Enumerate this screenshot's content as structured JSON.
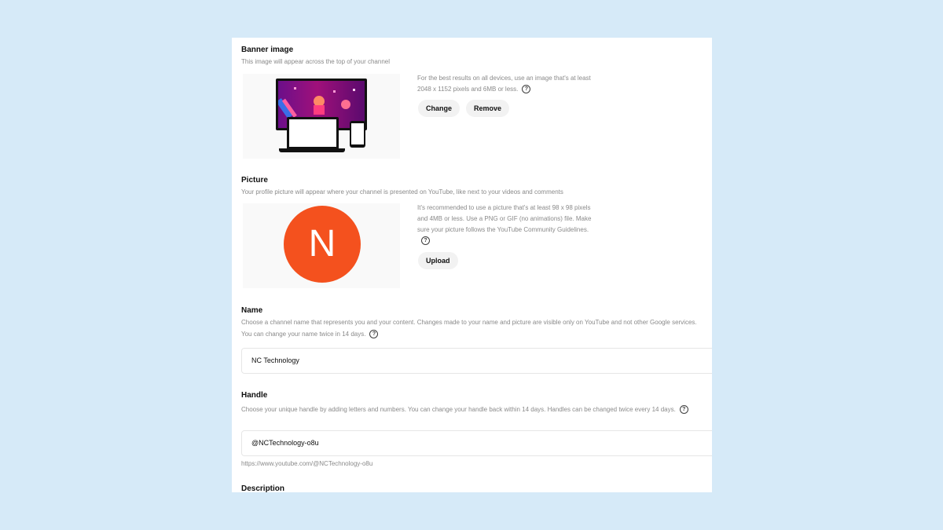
{
  "banner": {
    "title": "Banner image",
    "description": "This image will appear across the top of your channel",
    "hint": "For the best results on all devices, use an image that's at least 2048 x 1152 pixels and 6MB or less.",
    "change_label": "Change",
    "remove_label": "Remove"
  },
  "picture": {
    "title": "Picture",
    "description": "Your profile picture will appear where your channel is presented on YouTube, like next to your videos and comments",
    "avatar_letter": "N",
    "avatar_color": "#f4511e",
    "hint": "It's recommended to use a picture that's at least 98 x 98 pixels and 4MB or less. Use a PNG or GIF (no animations) file. Make sure your picture follows the YouTube Community Guidelines.",
    "upload_label": "Upload"
  },
  "name": {
    "title": "Name",
    "description": "Choose a channel name that represents you and your content. Changes made to your name and picture are visible only on YouTube and not other Google services. You can change your name twice in 14 days.",
    "value": "NC Technology"
  },
  "handle": {
    "title": "Handle",
    "description": "Choose your unique handle by adding letters and numbers. You can change your handle back within 14 days. Handles can be changed twice every 14 days.",
    "value": "@NCTechnology-o8u",
    "url": "https://www.youtube.com/@NCTechnology-o8u"
  },
  "description": {
    "title": "Description"
  },
  "icons": {
    "help": "help-icon"
  },
  "colors": {
    "background": "#d6eaf8",
    "panel": "#ffffff",
    "button_bg": "#f2f2f2"
  }
}
